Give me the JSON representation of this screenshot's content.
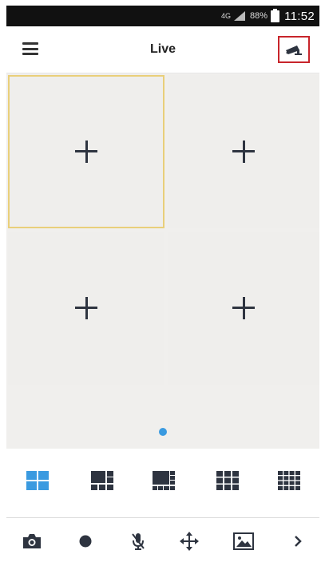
{
  "status_bar": {
    "signal": "4G",
    "battery": "88%",
    "time": "11:52"
  },
  "header": {
    "title": "Live",
    "menu_icon": "hamburger-menu-icon",
    "device_icon": "camera-device-icon"
  },
  "grid": {
    "tiles": [
      {
        "icon": "plus-icon",
        "selected": true
      },
      {
        "icon": "plus-icon",
        "selected": false
      },
      {
        "icon": "plus-icon",
        "selected": false
      },
      {
        "icon": "plus-icon",
        "selected": false
      }
    ],
    "pages": 1,
    "current_page": 1
  },
  "layouts": [
    {
      "icon": "layout-4-icon",
      "active": true
    },
    {
      "icon": "layout-6-icon",
      "active": false
    },
    {
      "icon": "layout-8-icon",
      "active": false
    },
    {
      "icon": "layout-9-icon",
      "active": false
    },
    {
      "icon": "layout-16-icon",
      "active": false
    }
  ],
  "toolbar": [
    {
      "icon": "camera-snapshot-icon"
    },
    {
      "icon": "record-icon"
    },
    {
      "icon": "microphone-muted-icon"
    },
    {
      "icon": "ptz-move-icon"
    },
    {
      "icon": "image-quality-icon"
    },
    {
      "icon": "chevron-right-icon"
    }
  ],
  "colors": {
    "accent": "#3a9ae0",
    "selected_border": "#e9cf7a",
    "highlight_box": "#c8252b",
    "icon_dark": "#2e3440"
  }
}
